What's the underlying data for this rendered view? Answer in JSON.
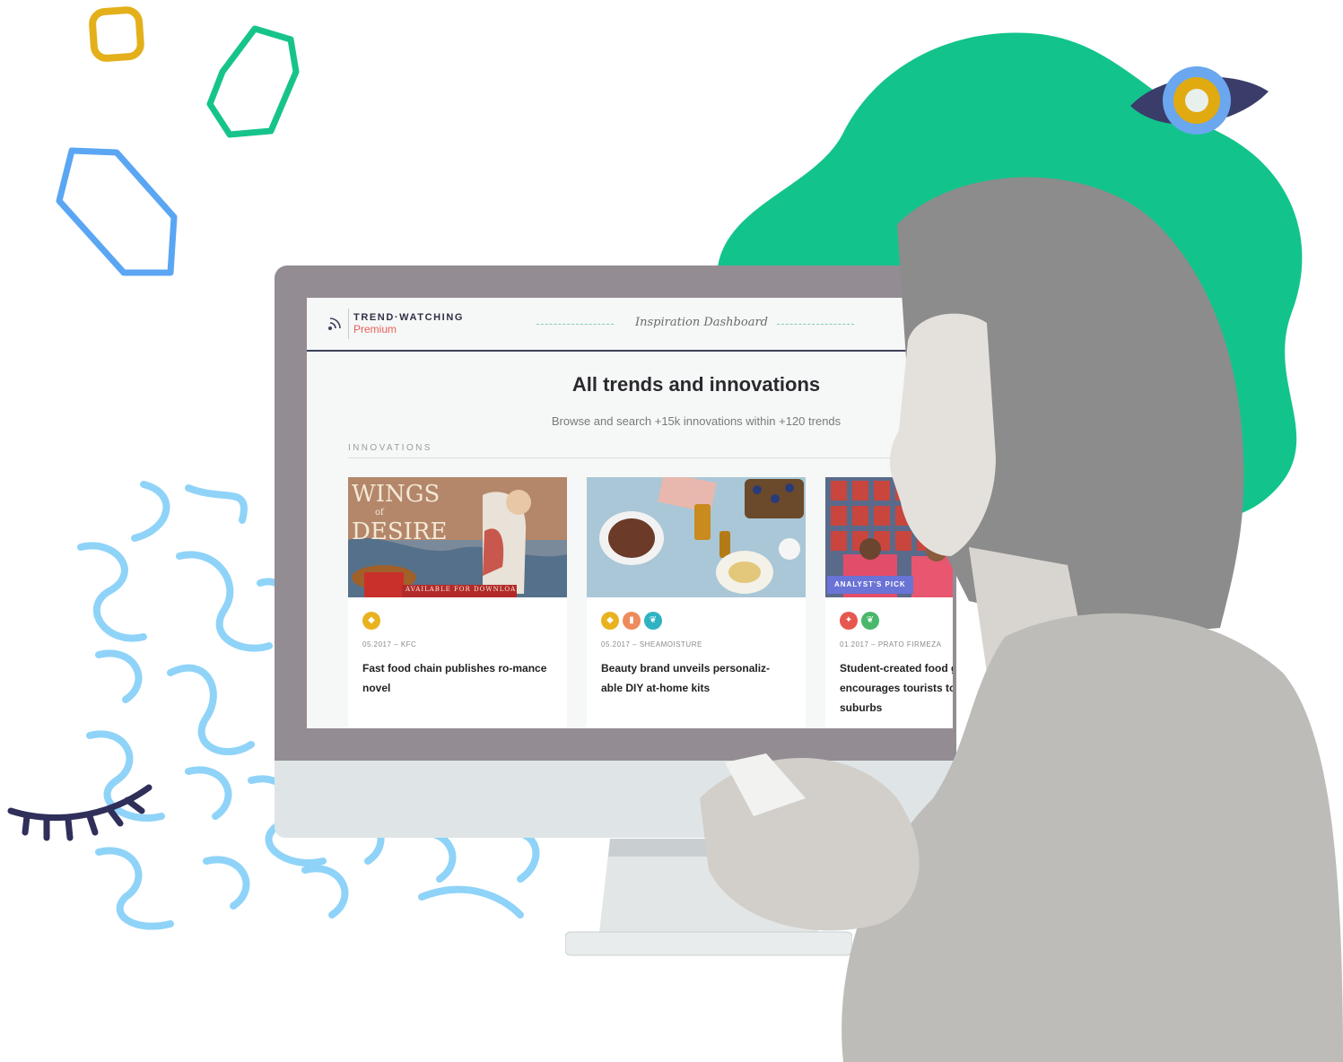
{
  "app": {
    "brand": "TREND·WATCHING",
    "brand_sub": "Premium",
    "dashboard_title": "Inspiration Dashboard"
  },
  "main": {
    "heading": "All trends and innovations",
    "subheading": "Browse and search +15k innovations within +120 trends",
    "section_label": "INNOVATIONS"
  },
  "cards": [
    {
      "meta": "05.2017 – KFC",
      "title": "Fast food chain publishes ro-mance novel",
      "image_text_top": "WINGS",
      "image_text_mid": "of",
      "image_text_bottom": "DESIRE",
      "image_banner": "AVAILABLE FOR DOWNLOAD"
    },
    {
      "meta": "05.2017 – SHEAMOISTURE",
      "title": "Beauty brand unveils personaliz-able DIY at-home kits"
    },
    {
      "meta": "01.2017 – PRATO FIRMEZA",
      "title": "Student-created food guide encourages tourists to explore suburbs",
      "badge": "ANALYST'S PICK"
    }
  ],
  "colors": {
    "green_blob": "#12c48b",
    "bezel": "#948c93",
    "navy": "#3c4058",
    "brand_red": "#e5605b",
    "icon_yellow": "#e9b21f",
    "icon_orange": "#ee8a5b",
    "icon_teal": "#2fb3c2",
    "icon_red": "#e6584f",
    "icon_green": "#49b86b",
    "badge_purple": "#6a73d6"
  },
  "icons": [
    "rss-icon",
    "gem-icon",
    "jar-icon",
    "leaf-icon",
    "lightbulb-icon"
  ]
}
